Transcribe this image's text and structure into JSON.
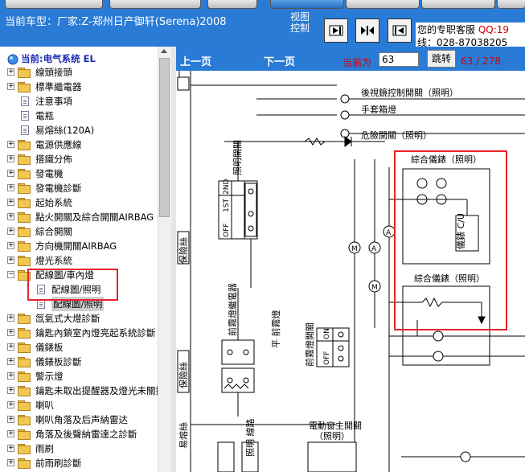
{
  "header": {
    "car_label": "当前车型：厂家:Z-郑州日产御轩(Serena)2008",
    "view_control_label": "视图控制",
    "service_line1": "您的专职客服",
    "service_qq": "QQ:19",
    "service_line2": "线：028-87038205",
    "view_buttons": [
      {
        "name": "show-left-panel-button",
        "icon": "arrow-right-bar-icon"
      },
      {
        "name": "split-view-button",
        "icon": "arrows-split-icon"
      },
      {
        "name": "hide-left-panel-button",
        "icon": "arrow-left-bar-icon"
      }
    ]
  },
  "nav": {
    "prev_page": "上一页",
    "next_page": "下一页",
    "current_label": "当前为",
    "current_page": "63",
    "jump_label": "跳转",
    "page_count": "63 / 278"
  },
  "sidebar": {
    "root_label": "当前:电气系统 EL",
    "items": [
      {
        "label": "線頭接頭",
        "type": "folder",
        "expandable": true
      },
      {
        "label": "標準繼電器",
        "type": "folder",
        "expandable": true
      },
      {
        "label": "注意事項",
        "type": "doc",
        "expandable": false
      },
      {
        "label": "電瓶",
        "type": "doc",
        "expandable": false
      },
      {
        "label": "易熔絲(120A)",
        "type": "doc",
        "expandable": false
      },
      {
        "label": "電源供應線",
        "type": "folder",
        "expandable": true
      },
      {
        "label": "搭鐵分佈",
        "type": "folder",
        "expandable": true
      },
      {
        "label": "發電機",
        "type": "folder",
        "expandable": true
      },
      {
        "label": "發電機診斷",
        "type": "folder",
        "expandable": true
      },
      {
        "label": "起始系統",
        "type": "folder",
        "expandable": true
      },
      {
        "label": "點火開關及綜合開關AIRBAG",
        "type": "folder",
        "expandable": true
      },
      {
        "label": "綜合開關",
        "type": "folder",
        "expandable": true
      },
      {
        "label": "方向機開關AIRBAG",
        "type": "folder",
        "expandable": true
      },
      {
        "label": "燈光系統",
        "type": "folder",
        "expandable": true
      },
      {
        "label": "配線圖/車內燈",
        "type": "folder",
        "expandable": true,
        "expanded": true
      },
      {
        "label": "配線圖/照明",
        "type": "doc",
        "expandable": false,
        "indent": true
      },
      {
        "label": "配線圖/照明",
        "type": "doc",
        "expandable": false,
        "indent": true,
        "selected": true
      },
      {
        "label": "氙氣式大燈診斷",
        "type": "folder",
        "expandable": true
      },
      {
        "label": "鑰匙內鎖室內燈亮起系統診斷",
        "type": "folder",
        "expandable": true
      },
      {
        "label": "儀錶板",
        "type": "folder",
        "expandable": true
      },
      {
        "label": "儀錶板診斷",
        "type": "folder",
        "expandable": true
      },
      {
        "label": "警示燈",
        "type": "folder",
        "expandable": true
      },
      {
        "label": "鑰匙未取出提醒器及燈光未關提",
        "type": "folder",
        "expandable": true
      },
      {
        "label": "喇叭",
        "type": "folder",
        "expandable": true
      },
      {
        "label": "喇叭角落及后声納雷达",
        "type": "folder",
        "expandable": true
      },
      {
        "label": "角落及後聲納雷達之診斷",
        "type": "folder",
        "expandable": true
      },
      {
        "label": "雨刷",
        "type": "folder",
        "expandable": true
      },
      {
        "label": "前雨刷診斷",
        "type": "folder",
        "expandable": true
      }
    ]
  },
  "diagram": {
    "labels": {
      "mirror_switch": "後視鏡控制開關（照明）",
      "ashtray": "手套箱燈",
      "hazard_switch": "危險開關（照明）",
      "combo_meter_1": "綜合儀錶（照明）",
      "combo_meter_2": "綜合儀錶（照明）",
      "meter_cu": "儀錶 C/U",
      "lighting_switch": "照明開關",
      "fuse_box_1": "保險絲",
      "fuse_box_2": "保險絲",
      "front_fog_relay": "前霧燈繼電器",
      "rear_fog_relay": "平 前霧燈",
      "fog_switch": "前霧燈開關",
      "window_switch": "電動窗主開關",
      "window_switch_sub": "（照明）",
      "bottom_label_1": "易熔絲",
      "bottom_label_2": "照明 線路",
      "switch_positions": [
        "OFF",
        "1ST",
        "2ND"
      ],
      "fog_positions": [
        "OFF",
        "ON"
      ],
      "meter_a": "A",
      "meter_m": "M"
    }
  },
  "colors": {
    "header_bg": "#2a7bd6",
    "highlight": "#e8232a",
    "accent_red": "#d00000"
  }
}
